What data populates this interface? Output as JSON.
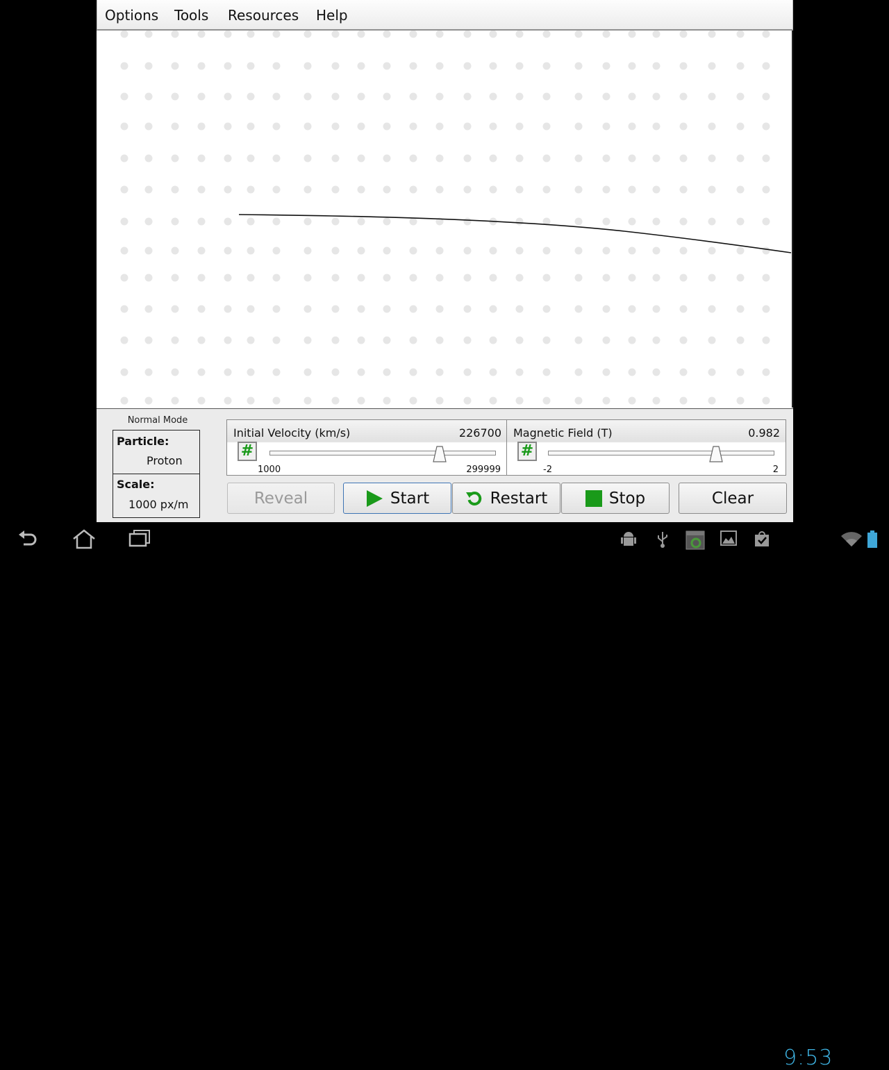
{
  "menu": {
    "items": [
      "Options",
      "Tools",
      "Resources",
      "Help"
    ]
  },
  "simulation": {
    "grid_rows": 13,
    "grid_cols": 25,
    "trajectory_label": "particle-path"
  },
  "panel": {
    "mode": "Normal Mode",
    "particle_label": "Particle:",
    "particle_value": "Proton",
    "scale_label": "Scale:",
    "scale_value": "1000 px/m",
    "velocity": {
      "title": "Initial Velocity (km/s)",
      "value": "226700",
      "min": "1000",
      "max": "299999",
      "fraction": 0.756
    },
    "field": {
      "title": "Magnetic Field (T)",
      "value": "0.982",
      "min": "-2",
      "max": "2",
      "fraction": 0.7455
    },
    "hash_icon": "#",
    "buttons": {
      "reveal": "Reveal",
      "start": "Start",
      "restart": "Restart",
      "stop": "Stop",
      "clear": "Clear"
    }
  },
  "colors": {
    "accent_green": "#1a9a1a",
    "clock_blue": "#3fb6e6"
  },
  "statusbar": {
    "time": "9:53"
  }
}
